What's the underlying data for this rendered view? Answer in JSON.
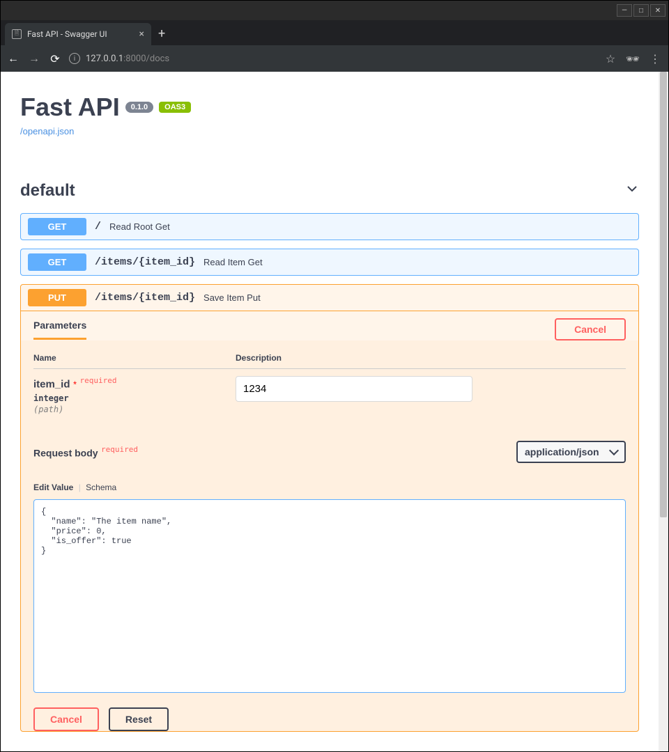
{
  "browser": {
    "tab_title": "Fast API - Swagger UI",
    "url_host": "127.0.0.1",
    "url_port": ":8000",
    "url_path": "/docs"
  },
  "api": {
    "title": "Fast API",
    "version": "0.1.0",
    "oas_badge": "OAS3",
    "schema_link": "/openapi.json"
  },
  "tag": {
    "name": "default"
  },
  "operations": [
    {
      "method": "GET",
      "path": "/",
      "summary": "Read Root Get"
    },
    {
      "method": "GET",
      "path": "/items/{item_id}",
      "summary": "Read Item Get"
    },
    {
      "method": "PUT",
      "path": "/items/{item_id}",
      "summary": "Save Item Put"
    }
  ],
  "params": {
    "tab_label": "Parameters",
    "cancel_label": "Cancel",
    "col_name": "Name",
    "col_desc": "Description",
    "rows": [
      {
        "name": "item_id",
        "required_star": "*",
        "required_text": "required",
        "type": "integer",
        "in": "(path)",
        "value": "1234"
      }
    ]
  },
  "request_body": {
    "label": "Request body",
    "required_text": "required",
    "content_type": "application/json",
    "editor_tabs": {
      "edit": "Edit Value",
      "schema": "Schema"
    },
    "body": "{\n  \"name\": \"The item name\",\n  \"price\": 0,\n  \"is_offer\": true\n}"
  },
  "footer_buttons": {
    "cancel": "Cancel",
    "reset": "Reset"
  }
}
